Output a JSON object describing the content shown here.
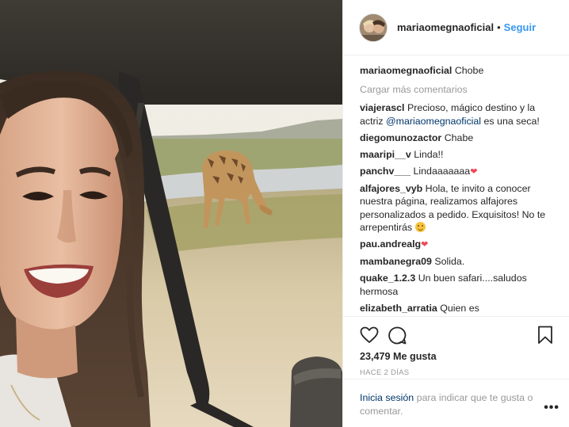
{
  "post": {
    "username": "mariaomegnaoficial",
    "separator": "•",
    "follow_label": "Seguir",
    "caption": {
      "user": "mariaomegnaoficial",
      "text": "Chobe"
    },
    "load_more": "Cargar más comentarios",
    "comments": [
      {
        "user": "viajerascl",
        "text_before": "Precioso, mágico destino y la actriz ",
        "mention": "@mariaomegnaoficial",
        "text_after": " es una seca!"
      },
      {
        "user": "diegomunozactor",
        "text": "Chabe"
      },
      {
        "user": "maaripi__v",
        "text": "Linda!!"
      },
      {
        "user": "panchv___",
        "text": "Lindaaaaaaa",
        "emoji": "heart"
      },
      {
        "user": "alfajores_vyb",
        "text": "Hola, te invito a conocer nuestra página, realizamos alfajores personalizados a pedido. Exquisitos! No te arrepentirás",
        "emoji": "smile"
      },
      {
        "user": "pau.andrealg",
        "text": "",
        "emoji": "heart"
      },
      {
        "user": "mambanegra09",
        "text": "Solida."
      },
      {
        "user": "quake_1.2.3",
        "text": "Un buen safari....saludos hermosa"
      },
      {
        "user": "elizabeth_arratia",
        "text": "Quien es"
      }
    ],
    "likes": "23,479 Me gusta",
    "time_ago": "Hace 2 días",
    "login_prompt": {
      "link": "Inicia sesión",
      "text": " para indicar que te gusta o comentar."
    },
    "more_options": "•••"
  },
  "icons": {
    "like": "heart-outline-icon",
    "comment": "speech-bubble-icon",
    "save": "bookmark-icon",
    "more": "ellipsis-icon"
  },
  "colors": {
    "link_blue": "#3897f0",
    "mention": "#003569",
    "muted": "#999999",
    "text": "#262626",
    "heart": "#ed4956"
  }
}
